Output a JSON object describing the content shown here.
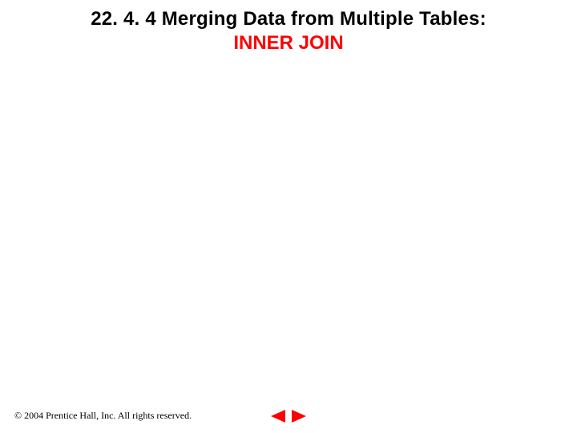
{
  "title": {
    "line1": "22. 4. 4 Merging Data from Multiple Tables:",
    "line2": "INNER JOIN"
  },
  "footer": {
    "copyright": "© 2004 Prentice Hall, Inc.  All rights reserved."
  },
  "nav": {
    "prev_icon": "triangle-left",
    "next_icon": "triangle-right",
    "color": "#ff0000"
  }
}
